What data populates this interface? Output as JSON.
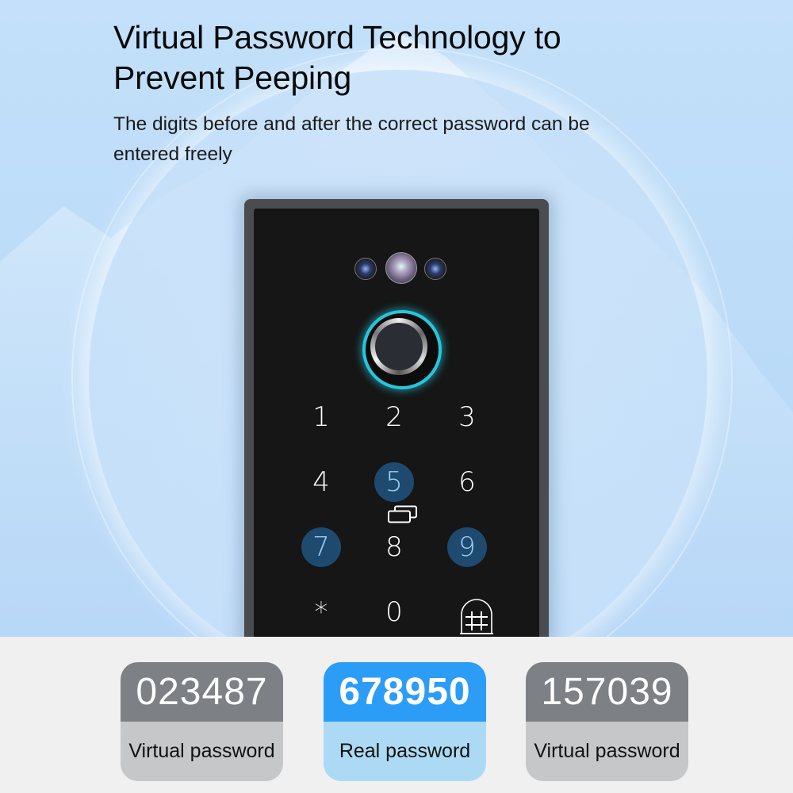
{
  "headline": {
    "line1": "Virtual Password Technology to",
    "line2": "Prevent Peeping"
  },
  "subtitle": "The digits before and after the correct password can be entered freely",
  "device": {
    "keypad": [
      {
        "label": "1",
        "highlighted": false
      },
      {
        "label": "2",
        "highlighted": false
      },
      {
        "label": "3",
        "highlighted": false
      },
      {
        "label": "4",
        "highlighted": false
      },
      {
        "label": "5",
        "highlighted": true
      },
      {
        "label": "6",
        "highlighted": false
      },
      {
        "label": "7",
        "highlighted": true
      },
      {
        "label": "8",
        "highlighted": false
      },
      {
        "label": "9",
        "highlighted": true
      },
      {
        "label": "*",
        "highlighted": false
      },
      {
        "label": "0",
        "highlighted": false
      },
      {
        "label": "#",
        "highlighted": false
      }
    ],
    "icons": [
      "camera-icon",
      "camera-icon",
      "camera-icon",
      "fingerprint-sensor-icon",
      "card-reader-icon",
      "doorbell-hash-icon"
    ],
    "fingerprint_ring_color": "#27c6dd",
    "highlight_color": "#1e4a70"
  },
  "passwords": [
    {
      "value": "023487",
      "label": "Virtual password",
      "type": "virtual"
    },
    {
      "value": "678950",
      "label": "Real password",
      "type": "real"
    },
    {
      "value": "157039",
      "label": "Virtual password",
      "type": "virtual"
    }
  ],
  "colors": {
    "real_accent": "#2b9df7",
    "real_label_bg": "#acdaf4",
    "virtual_value_bg": "#7d8185",
    "virtual_label_bg": "#c6c7c9"
  }
}
